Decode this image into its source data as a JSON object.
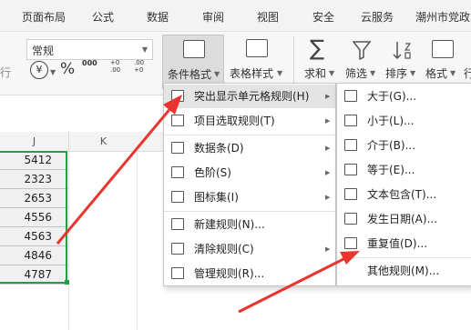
{
  "tabs": [
    "页面布局",
    "公式",
    "数据",
    "审阅",
    "视图",
    "安全",
    "云服务",
    "潮州市党政"
  ],
  "ribbon": {
    "number_format": "常规",
    "currency_symbol": "¥",
    "percent_symbol": "%",
    "thousands_symbol": "000",
    "decimal_increase": "+0 .00",
    "decimal_decrease": ".00 +0",
    "conditional_format": "条件格式",
    "table_style": "表格样式",
    "sum": "求和",
    "filter": "筛选",
    "sort": "排序",
    "format": "格式",
    "partial_right": "行",
    "partial_left": "行",
    "sigma": "∑"
  },
  "sheet": {
    "col_j": "J",
    "col_k": "K",
    "values": [
      "5412",
      "2323",
      "2653",
      "4556",
      "4563",
      "4846",
      "4787"
    ]
  },
  "main_menu": [
    "突出显示单元格规则(H)",
    "项目选取规则(T)",
    "数据条(D)",
    "色阶(S)",
    "图标集(I)",
    "新建规则(N)...",
    "清除规则(C)",
    "管理规则(R)..."
  ],
  "sub_menu": [
    "大于(G)...",
    "小于(L)...",
    "介于(B)...",
    "等于(E)...",
    "文本包含(T)...",
    "发生日期(A)...",
    "重复值(D)...",
    "其他规则(M)..."
  ],
  "colors": {
    "accent_green": "#23a047",
    "arrow_red": "#e8352f",
    "highlight": "#e4e4e4"
  }
}
